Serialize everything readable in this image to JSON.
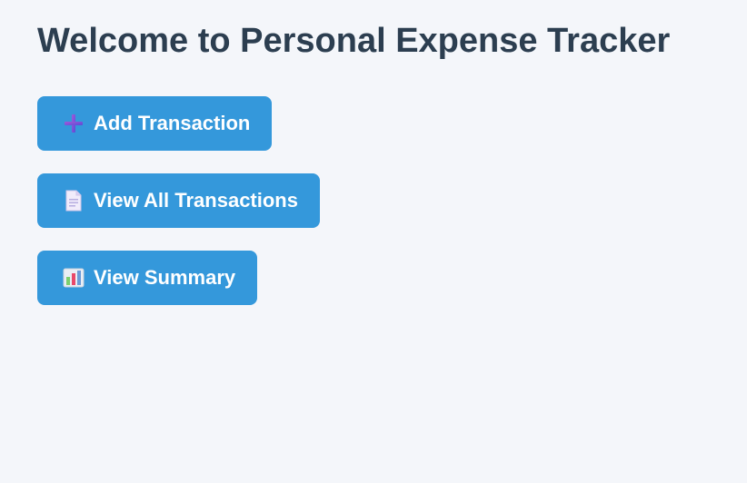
{
  "page": {
    "title": "Welcome to Personal Expense Tracker"
  },
  "actions": [
    {
      "label": "Add Transaction",
      "icon": "plus-icon"
    },
    {
      "label": "View All Transactions",
      "icon": "document-icon"
    },
    {
      "label": "View Summary",
      "icon": "bar-chart-icon"
    }
  ],
  "colors": {
    "background": "#f4f6fa",
    "title": "#2c3e50",
    "button": "#3498db",
    "button_text": "#ffffff"
  }
}
